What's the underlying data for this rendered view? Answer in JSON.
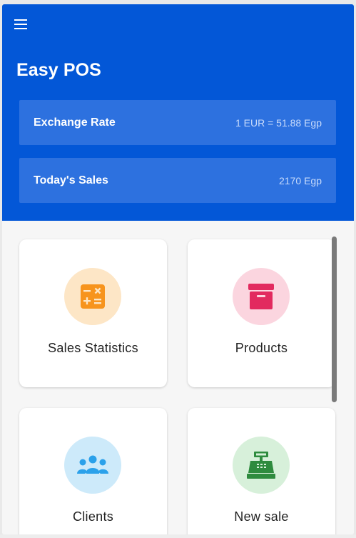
{
  "app": {
    "title": "Easy POS"
  },
  "header": {
    "menu_icon": "hamburger-menu-icon",
    "exchange_rate": {
      "label": "Exchange Rate",
      "value": "1 EUR = 51.88 Egp"
    },
    "todays_sales": {
      "label": "Today's Sales",
      "value": "2170 Egp"
    }
  },
  "tiles": [
    {
      "label": "Sales Statistics",
      "icon": "calculator-icon",
      "icon_color": "#f7941d",
      "circle_color": "#fde6c6"
    },
    {
      "label": "Products",
      "icon": "archive-box-icon",
      "icon_color": "#e22a5f",
      "circle_color": "#fbd5df"
    },
    {
      "label": "Clients",
      "icon": "users-group-icon",
      "icon_color": "#2ba1ea",
      "circle_color": "#cdeafa"
    },
    {
      "label": "New sale",
      "icon": "cash-register-icon",
      "icon_color": "#2e8b3e",
      "circle_color": "#d7f0da"
    }
  ],
  "colors": {
    "header_background": "#0357d7",
    "card_background": "#2d71df",
    "content_background": "#f6f6f6"
  }
}
